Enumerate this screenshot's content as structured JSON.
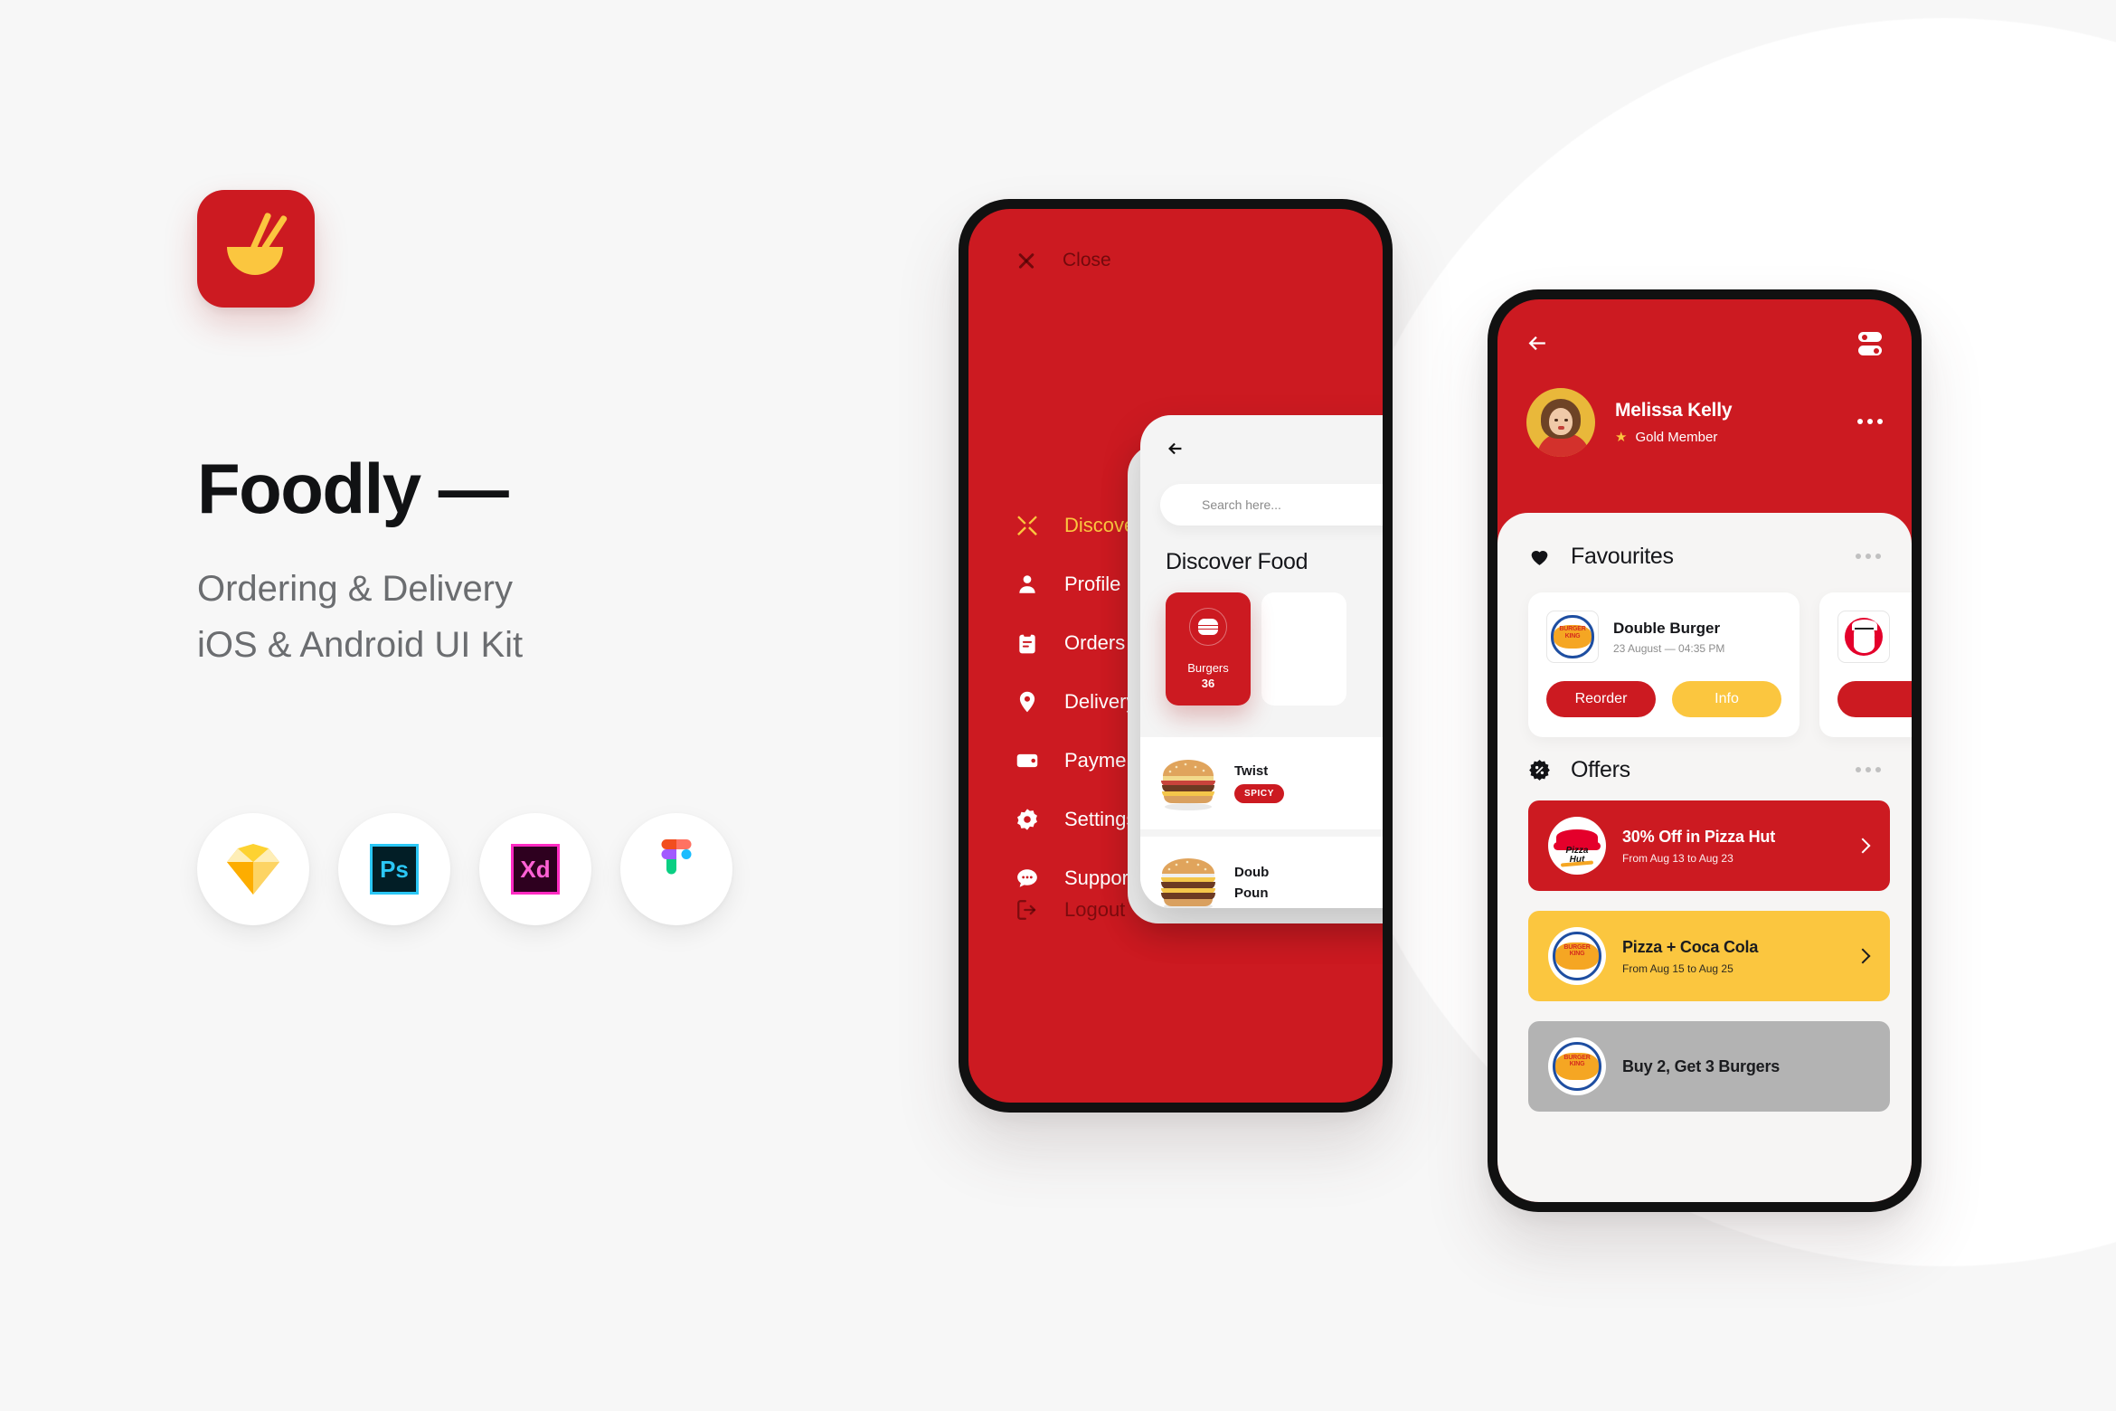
{
  "brand": {
    "app_icon_name": "noodle-bowl-icon",
    "title": "Foodly —",
    "subtitle_line1": "Ordering & Delivery",
    "subtitle_line2": "iOS & Android UI Kit",
    "accent_red": "#CC1A21",
    "accent_yellow": "#FBC63F",
    "background": "#F7F7F7"
  },
  "tools": [
    {
      "name": "Sketch",
      "icon": "sketch-icon"
    },
    {
      "name": "Ps",
      "icon": "photoshop-icon"
    },
    {
      "name": "Xd",
      "icon": "adobe-xd-icon"
    },
    {
      "name": "Figma",
      "icon": "figma-icon"
    }
  ],
  "drawer_screen": {
    "close_label": "Close",
    "nav_items": [
      {
        "label": "Discover",
        "icon": "cutlery-icon",
        "active": true
      },
      {
        "label": "Profile",
        "icon": "person-icon",
        "active": false
      },
      {
        "label": "Orders",
        "icon": "clipboard-icon",
        "active": false
      },
      {
        "label": "Delivery",
        "icon": "location-pin-icon",
        "active": false
      },
      {
        "label": "Payment",
        "icon": "wallet-icon",
        "active": false
      },
      {
        "label": "Settings",
        "icon": "gear-icon",
        "active": false
      },
      {
        "label": "Support",
        "icon": "chat-bubble-icon",
        "active": false
      }
    ],
    "logout_label": "Logout",
    "inner": {
      "search_placeholder": "Search here...",
      "heading": "Discover Food",
      "category": {
        "name": "Burgers",
        "count": "36",
        "icon": "burger-icon"
      },
      "food_items": [
        {
          "name": "Twist",
          "badge": "SPICY"
        },
        {
          "name_line1": "Doub",
          "name_line2": "Poun"
        }
      ]
    }
  },
  "profile_screen": {
    "user": {
      "name": "Melissa Kelly",
      "tier": "Gold Member",
      "star": "★"
    },
    "favourites": {
      "title": "Favourites",
      "icon": "heart-icon",
      "cards": [
        {
          "brand": "burger-king-logo",
          "title": "Double Burger",
          "subtitle": "23 August — 04:35 PM",
          "primary_label": "Reorder",
          "secondary_label": "Info"
        },
        {
          "brand": "kfc-logo",
          "title": "",
          "subtitle": "",
          "primary_label": "",
          "secondary_label": ""
        }
      ]
    },
    "offers": {
      "title": "Offers",
      "icon": "discount-badge-icon",
      "items": [
        {
          "brand": "pizza-hut-logo",
          "title": "30% Off in Pizza Hut",
          "subtitle": "From Aug 13 to Aug 23",
          "color": "red"
        },
        {
          "brand": "burger-king-logo",
          "title": "Pizza + Coca Cola",
          "subtitle": "From Aug 15 to Aug 25",
          "color": "yellow"
        },
        {
          "brand": "burger-king-logo",
          "title": "Buy 2, Get 3 Burgers",
          "subtitle": "",
          "color": "grey"
        }
      ]
    }
  }
}
